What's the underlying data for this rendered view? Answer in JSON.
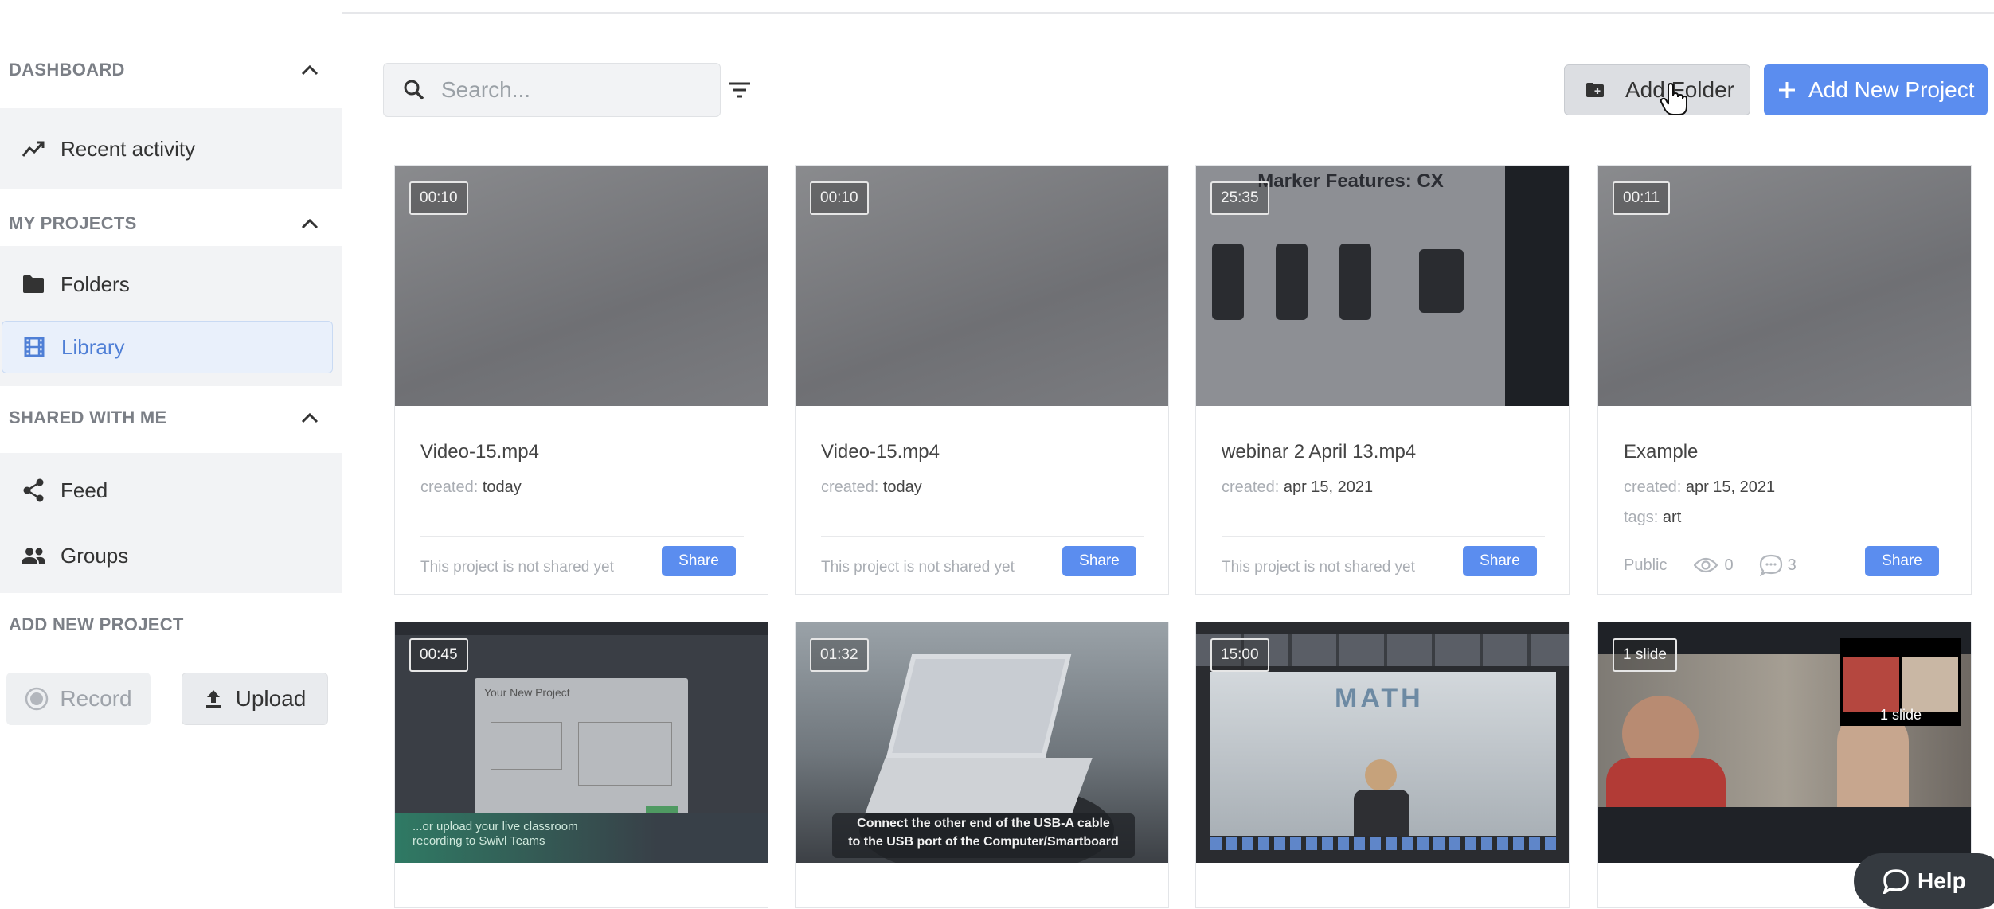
{
  "sidebar": {
    "dashboard": {
      "title": "DASHBOARD",
      "items": [
        {
          "label": "Recent activity",
          "icon": "trending-up-icon"
        }
      ]
    },
    "my_projects": {
      "title": "MY PROJECTS",
      "items": [
        {
          "label": "Folders",
          "icon": "folder-icon"
        },
        {
          "label": "Library",
          "icon": "film-icon",
          "active": true
        }
      ]
    },
    "shared": {
      "title": "SHARED WITH ME",
      "items": [
        {
          "label": "Feed",
          "icon": "share-icon"
        },
        {
          "label": "Groups",
          "icon": "groups-icon"
        }
      ]
    },
    "add_new": {
      "title": "ADD NEW PROJECT",
      "record_label": "Record",
      "upload_label": "Upload"
    }
  },
  "toolbar": {
    "search_placeholder": "Search...",
    "add_folder_label": "Add Folder",
    "add_project_label": "Add New Project"
  },
  "created_key": "created: ",
  "tags_key": "tags: ",
  "not_shared_text": "This project is not shared yet",
  "share_label": "Share",
  "cards": [
    {
      "duration": "00:10",
      "title": "Video-15.mp4",
      "created": "today"
    },
    {
      "duration": "00:10",
      "title": "Video-15.mp4",
      "created": "today"
    },
    {
      "duration": "25:35",
      "title": "webinar 2 April 13.mp4",
      "created": "apr 15, 2021",
      "thumb_heading": "Marker Features: CX"
    },
    {
      "duration": "00:11",
      "title": "Example",
      "created": "apr 15, 2021",
      "tags": "art",
      "visibility": "Public",
      "views": "0",
      "comments": "3"
    },
    {
      "duration": "00:45",
      "thumb_caption": "...or upload your live classroom recording to Swivl Teams",
      "thumb_heading": "Your New Project"
    },
    {
      "duration": "01:32",
      "thumb_caption_line1": "Connect the other end of the USB-A cable",
      "thumb_caption_line2": "to the USB port of the Computer/Smartboard"
    },
    {
      "duration": "15:00",
      "thumb_heading": "MATH"
    },
    {
      "duration": "1 slide",
      "thumb_overlay": "1 slide"
    }
  ],
  "help_label": "Help",
  "colors": {
    "accent": "#5b8def",
    "sidebar_bg": "#f2f3f5",
    "active_bg": "#e9f0fb"
  }
}
